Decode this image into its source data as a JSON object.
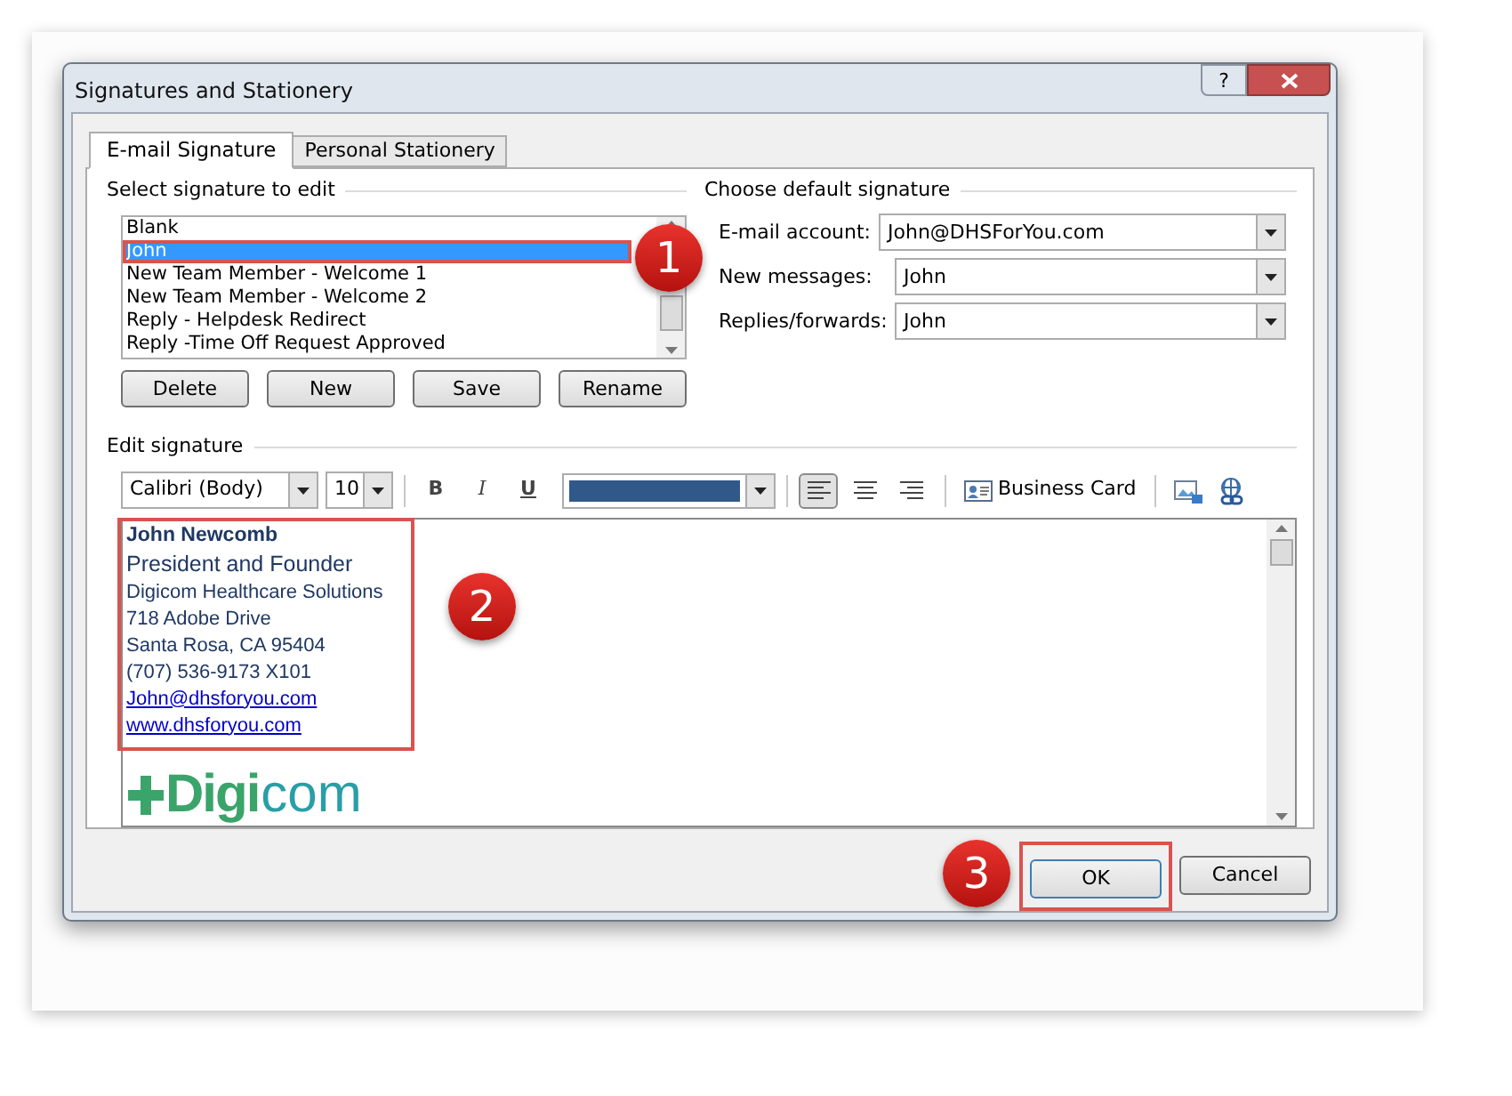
{
  "window": {
    "title": "Signatures and Stationery",
    "help_button": "?"
  },
  "tabs": [
    {
      "label": "E-mail Signature",
      "selected": true
    },
    {
      "label": "Personal Stationery",
      "selected": false
    }
  ],
  "select_signature": {
    "heading": "Select signature to edit",
    "items": [
      {
        "label": "Blank",
        "selected": false
      },
      {
        "label": "John",
        "selected": true
      },
      {
        "label": "New Team Member - Welcome 1",
        "selected": false
      },
      {
        "label": "New Team Member - Welcome 2",
        "selected": false
      },
      {
        "label": "Reply - Helpdesk Redirect",
        "selected": false
      },
      {
        "label": "Reply -Time Off Request Approved",
        "selected": false
      }
    ],
    "buttons": [
      "Delete",
      "New",
      "Save",
      "Rename"
    ]
  },
  "default_signature": {
    "heading": "Choose default signature",
    "fields": [
      {
        "label": "E-mail account:",
        "value": "John@DHSForYou.com"
      },
      {
        "label": "New messages:",
        "value": "John"
      },
      {
        "label": "Replies/forwards:",
        "value": "John"
      }
    ]
  },
  "edit_signature": {
    "heading": "Edit signature",
    "font": "Calibri (Body)",
    "size": "10",
    "format_buttons": [
      {
        "kind": "bold",
        "label": "B"
      },
      {
        "kind": "italic",
        "label": "I"
      },
      {
        "kind": "underline",
        "label": "U"
      }
    ],
    "alignment_buttons": [
      {
        "kind": "left",
        "selected": true
      },
      {
        "kind": "center",
        "selected": false
      },
      {
        "kind": "right",
        "selected": false
      }
    ],
    "business_card": "Business Card",
    "lines": [
      {
        "kind": "name",
        "text": "John Newcomb"
      },
      {
        "kind": "title",
        "text": "President and Founder"
      },
      {
        "kind": "plain",
        "text": "Digicom Healthcare Solutions"
      },
      {
        "kind": "plain",
        "text": "718 Adobe Drive"
      },
      {
        "kind": "plain",
        "text": "Santa Rosa, CA 95404"
      },
      {
        "kind": "plain",
        "text": "(707) 536-9173 X101"
      },
      {
        "kind": "link",
        "text": "John@dhsforyou.com"
      },
      {
        "kind": "link",
        "text": "www.dhsforyou.com"
      }
    ],
    "logo": {
      "bold_part": "Digi",
      "light_part": "com"
    }
  },
  "buttons": [
    {
      "kind": "ok",
      "label": "OK"
    },
    {
      "kind": "cancel",
      "label": "Cancel"
    }
  ],
  "callouts": [
    "1",
    "2",
    "3"
  ]
}
